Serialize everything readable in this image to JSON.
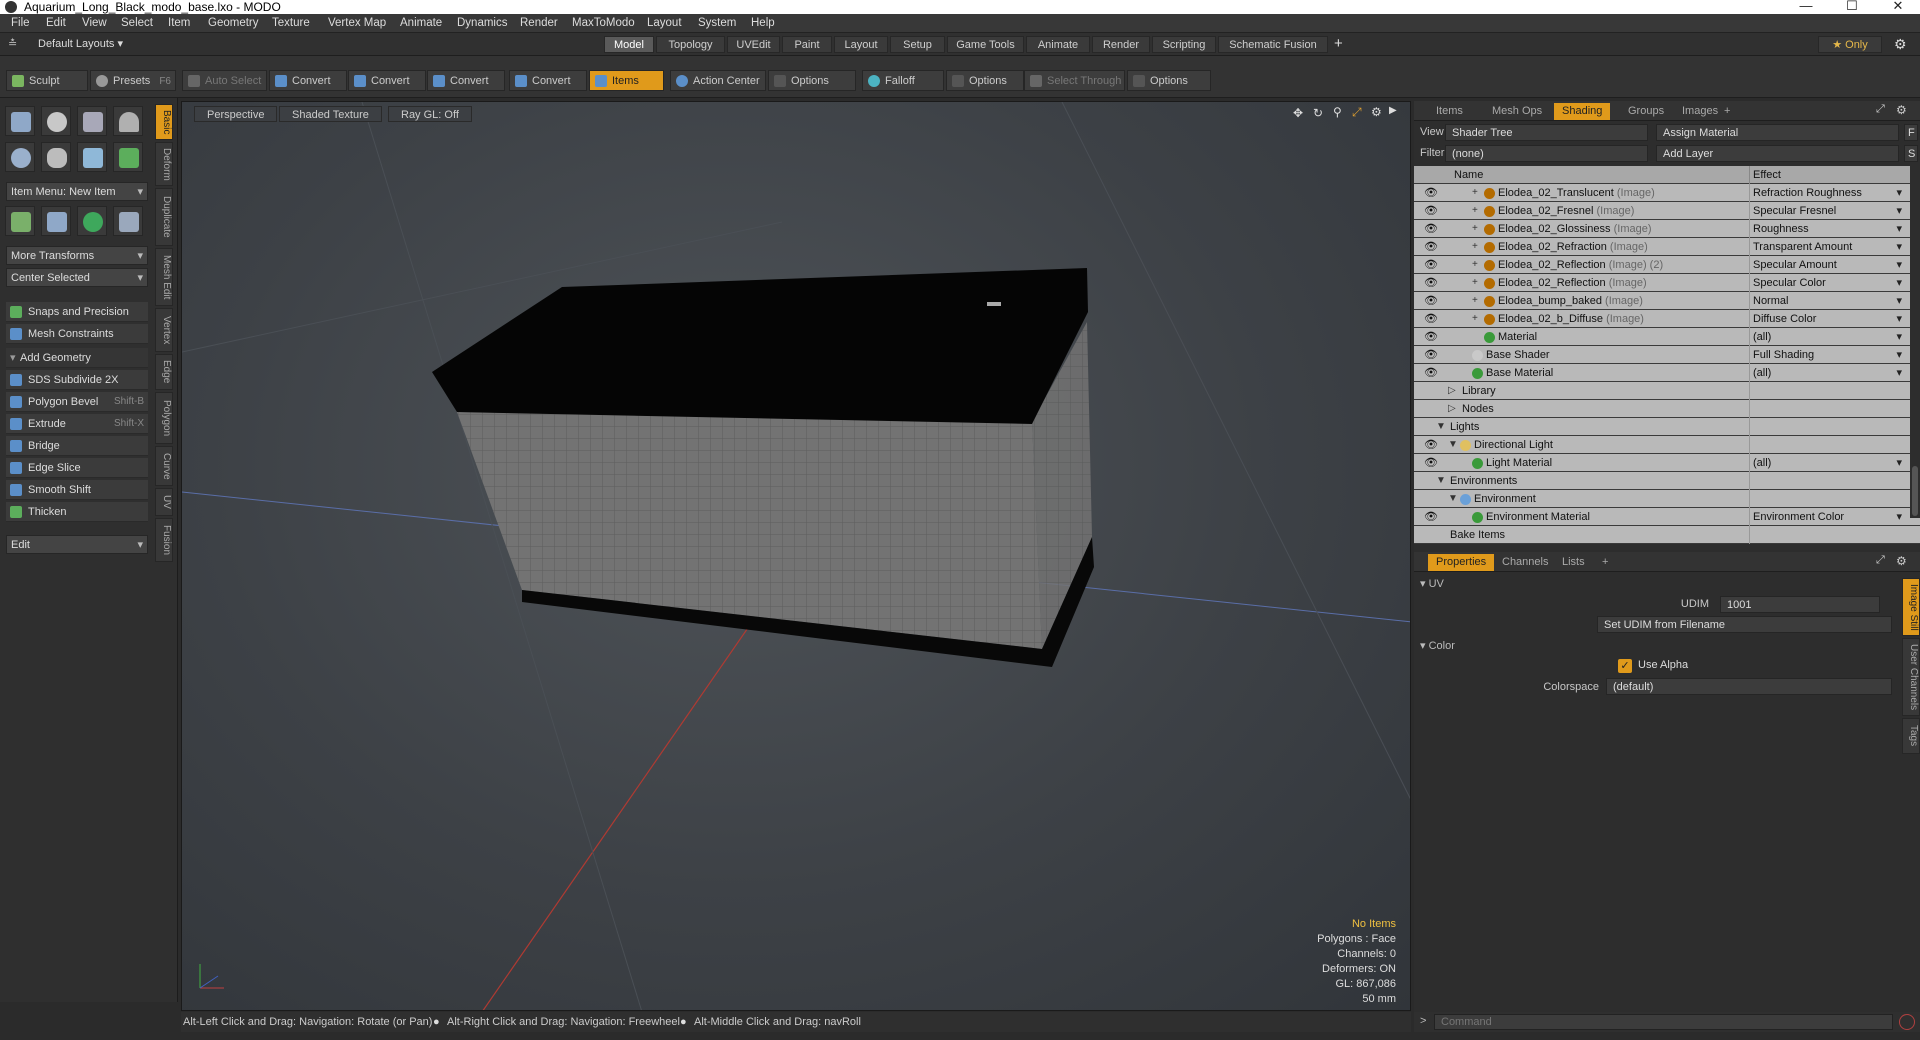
{
  "window": {
    "title": "Aquarium_Long_Black_modo_base.lxo - MODO",
    "min": "—",
    "max": "☐",
    "close": "✕"
  },
  "menu": [
    "File",
    "Edit",
    "View",
    "Select",
    "Item",
    "Geometry",
    "Texture",
    "Vertex Map",
    "Animate",
    "Dynamics",
    "Render",
    "MaxToModo",
    "Layout",
    "System",
    "Help"
  ],
  "layouts": {
    "name": "Default Layouts ▾",
    "tabs": [
      "Model",
      "Topology",
      "UVEdit",
      "Paint",
      "Layout",
      "Setup",
      "Game Tools",
      "Animate",
      "Render",
      "Scripting",
      "Schematic Fusion"
    ],
    "active": "Model",
    "plus": "+",
    "only": "★ Only"
  },
  "toolbar": {
    "sculpt": "Sculpt",
    "presets": "Presets",
    "presets_key": "F6",
    "auto_select": "Auto Select",
    "convert": "Convert",
    "items": "Items",
    "action_center": "Action Center",
    "options": "Options",
    "falloff": "Falloff",
    "select_through": "Select Through"
  },
  "left": {
    "item_menu": "Item Menu: New Item",
    "more_transforms": "More Transforms",
    "center_selected": "Center Selected",
    "snaps": "Snaps and Precision",
    "mesh_constraints": "Mesh Constraints",
    "add_geometry": "Add Geometry",
    "tools": [
      {
        "label": "SDS Subdivide 2X",
        "key": ""
      },
      {
        "label": "Polygon Bevel",
        "key": "Shift-B"
      },
      {
        "label": "Extrude",
        "key": "Shift-X"
      },
      {
        "label": "Bridge",
        "key": ""
      },
      {
        "label": "Edge Slice",
        "key": ""
      },
      {
        "label": "Smooth Shift",
        "key": ""
      },
      {
        "label": "Thicken",
        "key": ""
      }
    ],
    "edit": "Edit"
  },
  "vtabs": [
    "Basic",
    "Deform",
    "Duplicate",
    "Mesh Edit",
    "Vertex",
    "Edge",
    "Polygon",
    "Curve",
    "UV",
    "Fusion"
  ],
  "viewport": {
    "perspective": "Perspective",
    "shaded": "Shaded Texture",
    "raygl": "Ray GL: Off",
    "info": {
      "items": "No Items",
      "polygons": "Polygons : Face",
      "channels": "Channels: 0",
      "deformers": "Deformers: ON",
      "gl": "GL: 867,086",
      "mm": "50 mm"
    }
  },
  "status": {
    "hint1": "Alt-Left Click and Drag: Navigation: Rotate (or Pan)",
    "hint2": "Alt-Right Click and Drag: Navigation: Freewheel",
    "hint3": "Alt-Middle Click and Drag: navRoll",
    "bullet": "●"
  },
  "shading": {
    "tabs": [
      "Items",
      "Mesh Ops",
      "Shading",
      "Groups",
      "Images"
    ],
    "active": "Shading",
    "plus": "+",
    "view_label": "View",
    "view_value": "Shader Tree",
    "assign": "Assign Material",
    "filter_label": "Filter",
    "filter_value": "(none)",
    "add_layer": "Add Layer",
    "col_name": "Name",
    "col_effect": "Effect",
    "rows": [
      {
        "name": "Elodea_02_Translucent",
        "tag": "(Image)",
        "effect": "Refraction Roughness",
        "indent": 3,
        "exp": "+",
        "eye": true,
        "drop": true,
        "color": "#b36b00"
      },
      {
        "name": "Elodea_02_Fresnel",
        "tag": "(Image)",
        "effect": "Specular Fresnel",
        "indent": 3,
        "exp": "+",
        "eye": true,
        "drop": true,
        "color": "#b36b00"
      },
      {
        "name": "Elodea_02_Glossiness",
        "tag": "(Image)",
        "effect": "Roughness",
        "indent": 3,
        "exp": "+",
        "eye": true,
        "drop": true,
        "color": "#b36b00"
      },
      {
        "name": "Elodea_02_Refraction",
        "tag": "(Image)",
        "effect": "Transparent Amount",
        "indent": 3,
        "exp": "+",
        "eye": true,
        "drop": true,
        "color": "#b36b00"
      },
      {
        "name": "Elodea_02_Reflection",
        "tag": "(Image) (2)",
        "effect": "Specular Amount",
        "indent": 3,
        "exp": "+",
        "eye": true,
        "drop": true,
        "color": "#b36b00"
      },
      {
        "name": "Elodea_02_Reflection",
        "tag": "(Image)",
        "effect": "Specular Color",
        "indent": 3,
        "exp": "+",
        "eye": true,
        "drop": true,
        "color": "#b36b00"
      },
      {
        "name": "Elodea_bump_baked",
        "tag": "(Image)",
        "effect": "Normal",
        "indent": 3,
        "exp": "+",
        "eye": true,
        "drop": true,
        "color": "#b36b00"
      },
      {
        "name": "Elodea_02_b_Diffuse",
        "tag": "(Image)",
        "effect": "Diffuse Color",
        "indent": 3,
        "exp": "+",
        "eye": true,
        "drop": true,
        "color": "#b36b00"
      },
      {
        "name": "Material",
        "tag": "",
        "effect": "(all)",
        "indent": 3,
        "exp": "",
        "eye": true,
        "drop": true,
        "color": "#3a9a3a"
      },
      {
        "name": "Base Shader",
        "tag": "",
        "effect": "Full Shading",
        "indent": 2,
        "exp": "",
        "eye": true,
        "drop": true,
        "color": "#c9c9c9"
      },
      {
        "name": "Base Material",
        "tag": "",
        "effect": "(all)",
        "indent": 2,
        "exp": "",
        "eye": true,
        "drop": true,
        "color": "#3a9a3a"
      },
      {
        "name": "Library",
        "tag": "",
        "effect": "",
        "indent": 1,
        "exp": "▷",
        "eye": false,
        "drop": false,
        "color": ""
      },
      {
        "name": "Nodes",
        "tag": "",
        "effect": "",
        "indent": 1,
        "exp": "▷",
        "eye": false,
        "drop": false,
        "color": ""
      },
      {
        "name": "Lights",
        "tag": "",
        "effect": "",
        "indent": 0,
        "exp": "▼",
        "eye": false,
        "drop": false,
        "color": ""
      },
      {
        "name": "Directional Light",
        "tag": "",
        "effect": "",
        "indent": 1,
        "exp": "▼",
        "eye": true,
        "drop": false,
        "color": "#e0c060"
      },
      {
        "name": "Light Material",
        "tag": "",
        "effect": "(all)",
        "indent": 2,
        "exp": "",
        "eye": true,
        "drop": true,
        "color": "#3a9a3a"
      },
      {
        "name": "Environments",
        "tag": "",
        "effect": "",
        "indent": 0,
        "exp": "▼",
        "eye": false,
        "drop": false,
        "color": ""
      },
      {
        "name": "Environment",
        "tag": "",
        "effect": "",
        "indent": 1,
        "exp": "▼",
        "eye": false,
        "drop": false,
        "color": "#6aa0d8"
      },
      {
        "name": "Environment Material",
        "tag": "",
        "effect": "Environment Color",
        "indent": 2,
        "exp": "",
        "eye": true,
        "drop": true,
        "color": "#3a9a3a"
      },
      {
        "name": "Bake Items",
        "tag": "",
        "effect": "",
        "indent": 0,
        "exp": "",
        "eye": false,
        "drop": false,
        "color": ""
      }
    ]
  },
  "properties": {
    "tabs": [
      "Properties",
      "Channels",
      "Lists"
    ],
    "active": "Properties",
    "plus": "+",
    "uv_section": "UV",
    "udim_label": "UDIM",
    "udim_value": "1001",
    "set_udim": "Set UDIM from Filename",
    "color_section": "Color",
    "use_alpha": "Use Alpha",
    "colorspace_label": "Colorspace",
    "colorspace_value": "(default)",
    "side_tabs": [
      "Image Still",
      "User Channels",
      "Tags"
    ]
  },
  "command": {
    "placeholder": "Command"
  }
}
